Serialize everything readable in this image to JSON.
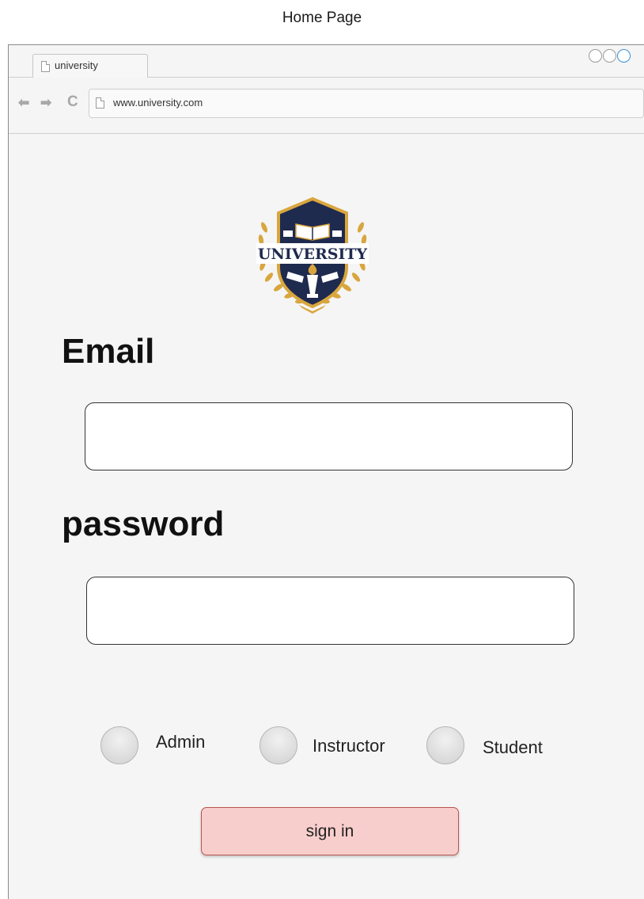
{
  "caption": "Home Page",
  "browser": {
    "tab_title": "university",
    "url": "www.university.com"
  },
  "logo": {
    "text": "UNIVERSITY",
    "colors": {
      "navy": "#1f2a4f",
      "gold": "#d9a63e"
    }
  },
  "form": {
    "email_label": "Email",
    "email_value": "",
    "password_label": "password",
    "password_value": "",
    "roles": [
      {
        "label": "Admin"
      },
      {
        "label": "Instructor"
      },
      {
        "label": "Student"
      }
    ],
    "submit_label": "sign in"
  },
  "colors": {
    "button_fill": "#f8cecc",
    "button_border": "#b85450",
    "page_background": "#f5f5f5"
  }
}
